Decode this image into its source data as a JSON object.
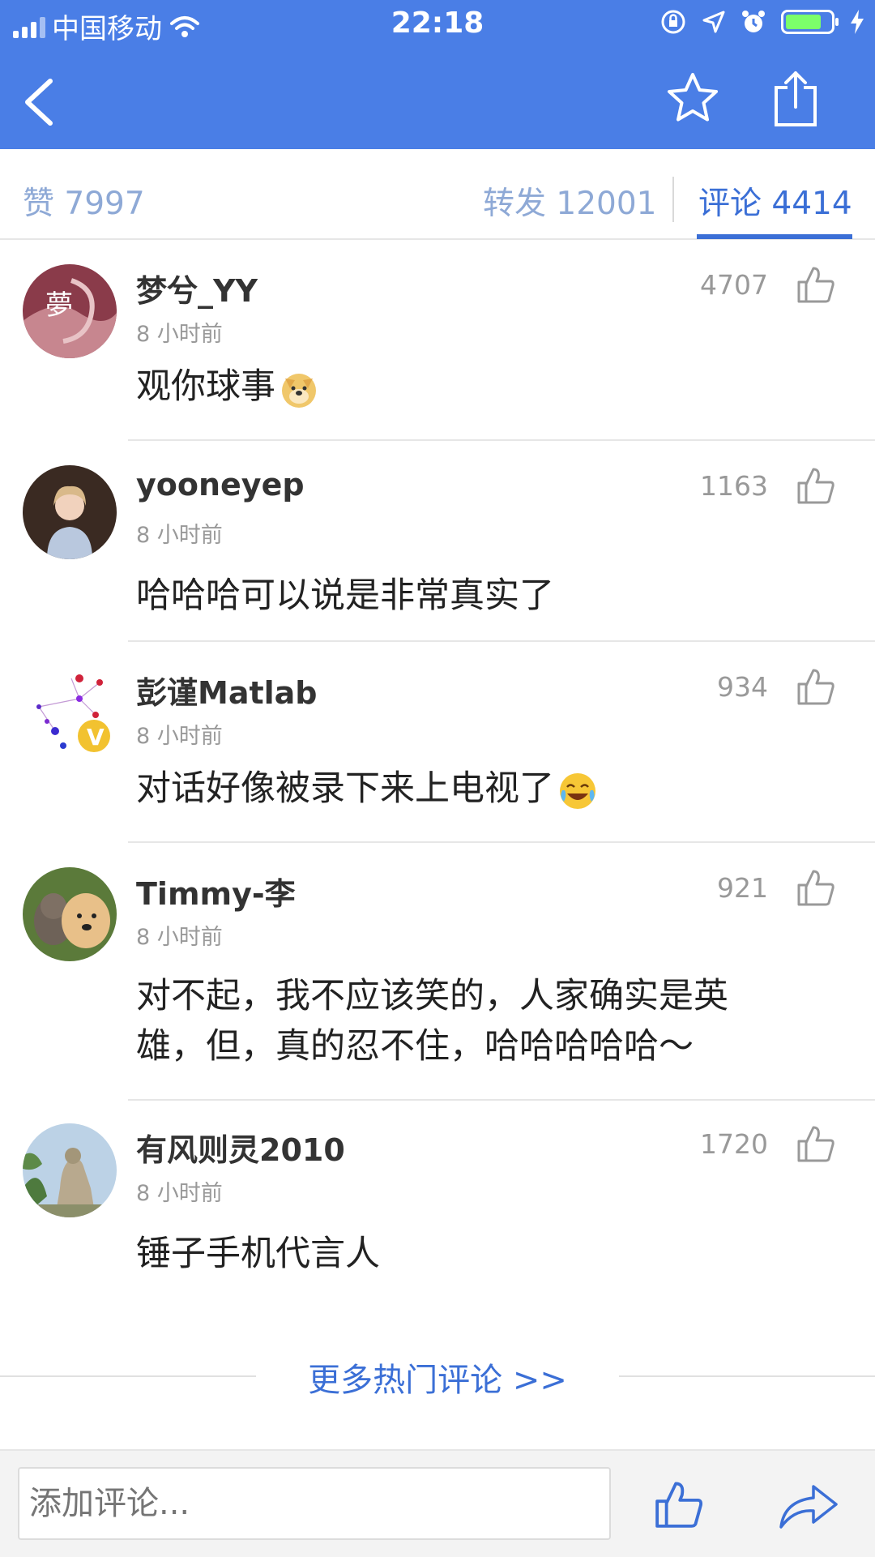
{
  "status_bar": {
    "carrier": "中国移动",
    "time": "22:18"
  },
  "tabs": {
    "likes_label": "赞 7997",
    "reposts_label": "转发 12001",
    "comments_label": "评论 4414",
    "active": "comments"
  },
  "comments": [
    {
      "name": "梦兮_YY",
      "time": "8 小时前",
      "text": "观你球事",
      "likes": "4707",
      "emoji": "doge"
    },
    {
      "name": "yooneyep",
      "time": "8 小时前",
      "text": "哈哈哈可以说是非常真实了",
      "likes": "1163"
    },
    {
      "name": "彭谨Matlab",
      "time": "8 小时前",
      "text": "对话好像被录下来上电视了",
      "likes": "934",
      "emoji": "laugh-cry",
      "verified": "V"
    },
    {
      "name": "Timmy-李",
      "time": "8 小时前",
      "text_line1": "对不起，我不应该笑的，人家确实是英",
      "text_line2": "雄，但，真的忍不住，哈哈哈哈哈～",
      "likes": "921"
    },
    {
      "name": "有风则灵2010",
      "time": "8 小时前",
      "text": "锤子手机代言人",
      "likes": "1720"
    }
  ],
  "more_comments": "更多热门评论 >>",
  "bottom_bar": {
    "input_placeholder": "添加评论..."
  },
  "colors": {
    "header_blue": "#4a7ee6",
    "accent_blue": "#3b6fd6",
    "muted_blue": "#8ea9d6"
  }
}
